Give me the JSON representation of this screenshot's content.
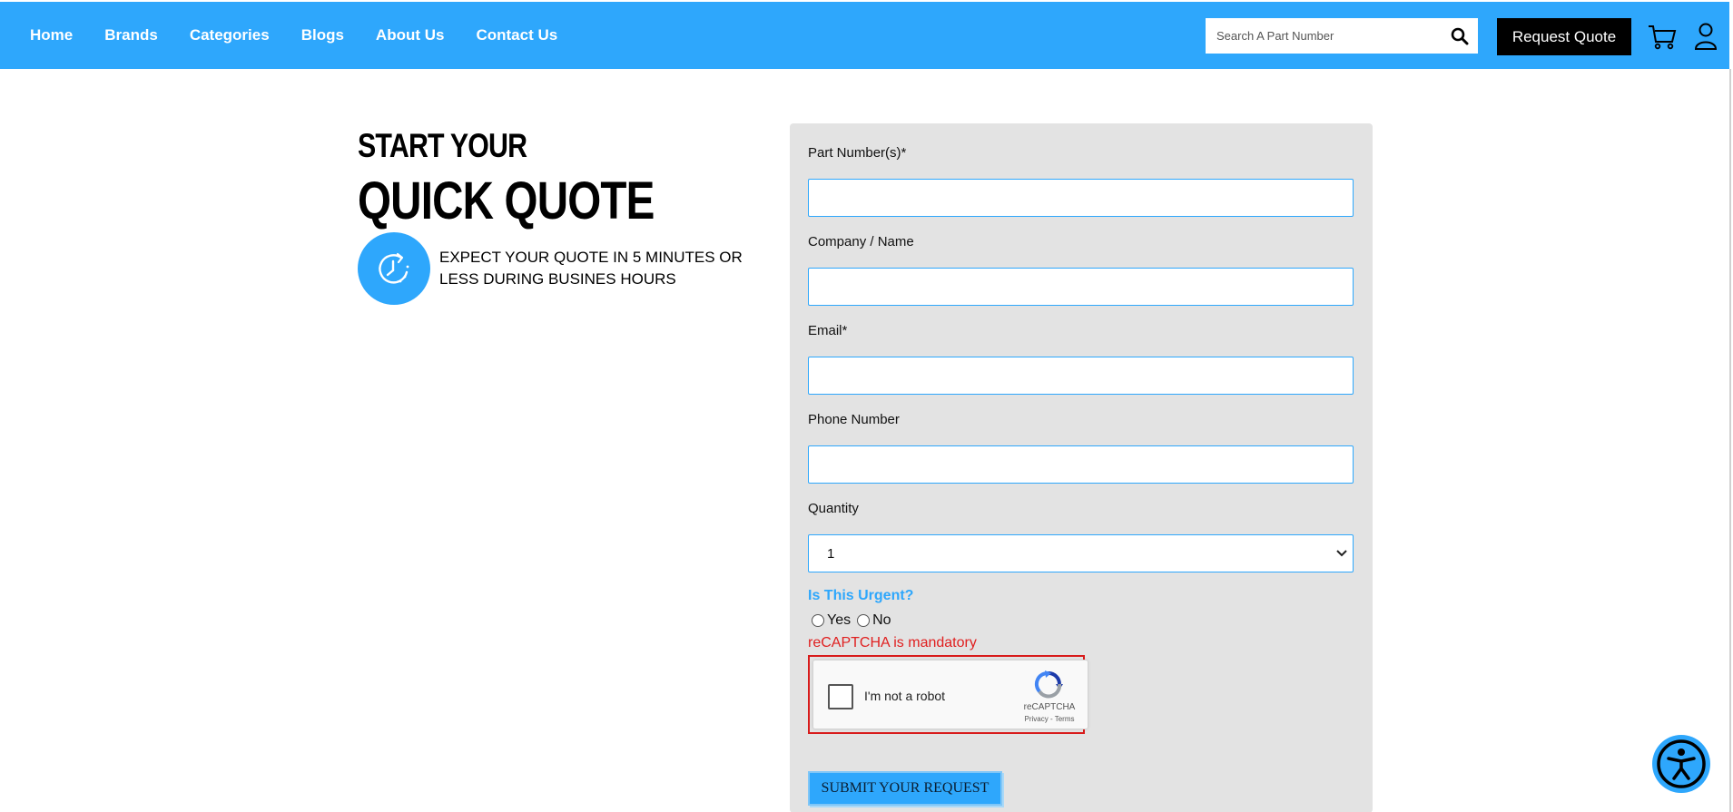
{
  "header": {
    "nav": [
      "Home",
      "Brands",
      "Categories",
      "Blogs",
      "About Us",
      "Contact Us"
    ],
    "search_placeholder": "Search A Part Number",
    "request_quote_label": "Request Quote",
    "icons": [
      "search-icon",
      "cart-icon",
      "user-icon"
    ],
    "bar_color": "#2ea7fc"
  },
  "hero": {
    "line1": "START YOUR",
    "line2": "QUICK QUOTE",
    "expect_text": "EXPECT YOUR QUOTE IN 5 MINUTES OR LESS DURING BUSINES HOURS",
    "icon": "clock-icon"
  },
  "form": {
    "part_label": "Part Number(s)*",
    "company_label": "Company / Name",
    "email_label": "Email*",
    "phone_label": "Phone Number",
    "quantity_label": "Quantity",
    "quantity_value": "1",
    "urgent_label": "Is This Urgent?",
    "urgent_options": [
      "Yes",
      "No"
    ],
    "captcha_error": "reCAPTCHA is mandatory",
    "captcha_label": "I'm not a robot",
    "captcha_brand": "reCAPTCHA",
    "captcha_links": "Privacy - Terms",
    "submit_label": "SUBMIT YOUR REQUEST"
  },
  "accessibility_icon": "accessibility-icon"
}
